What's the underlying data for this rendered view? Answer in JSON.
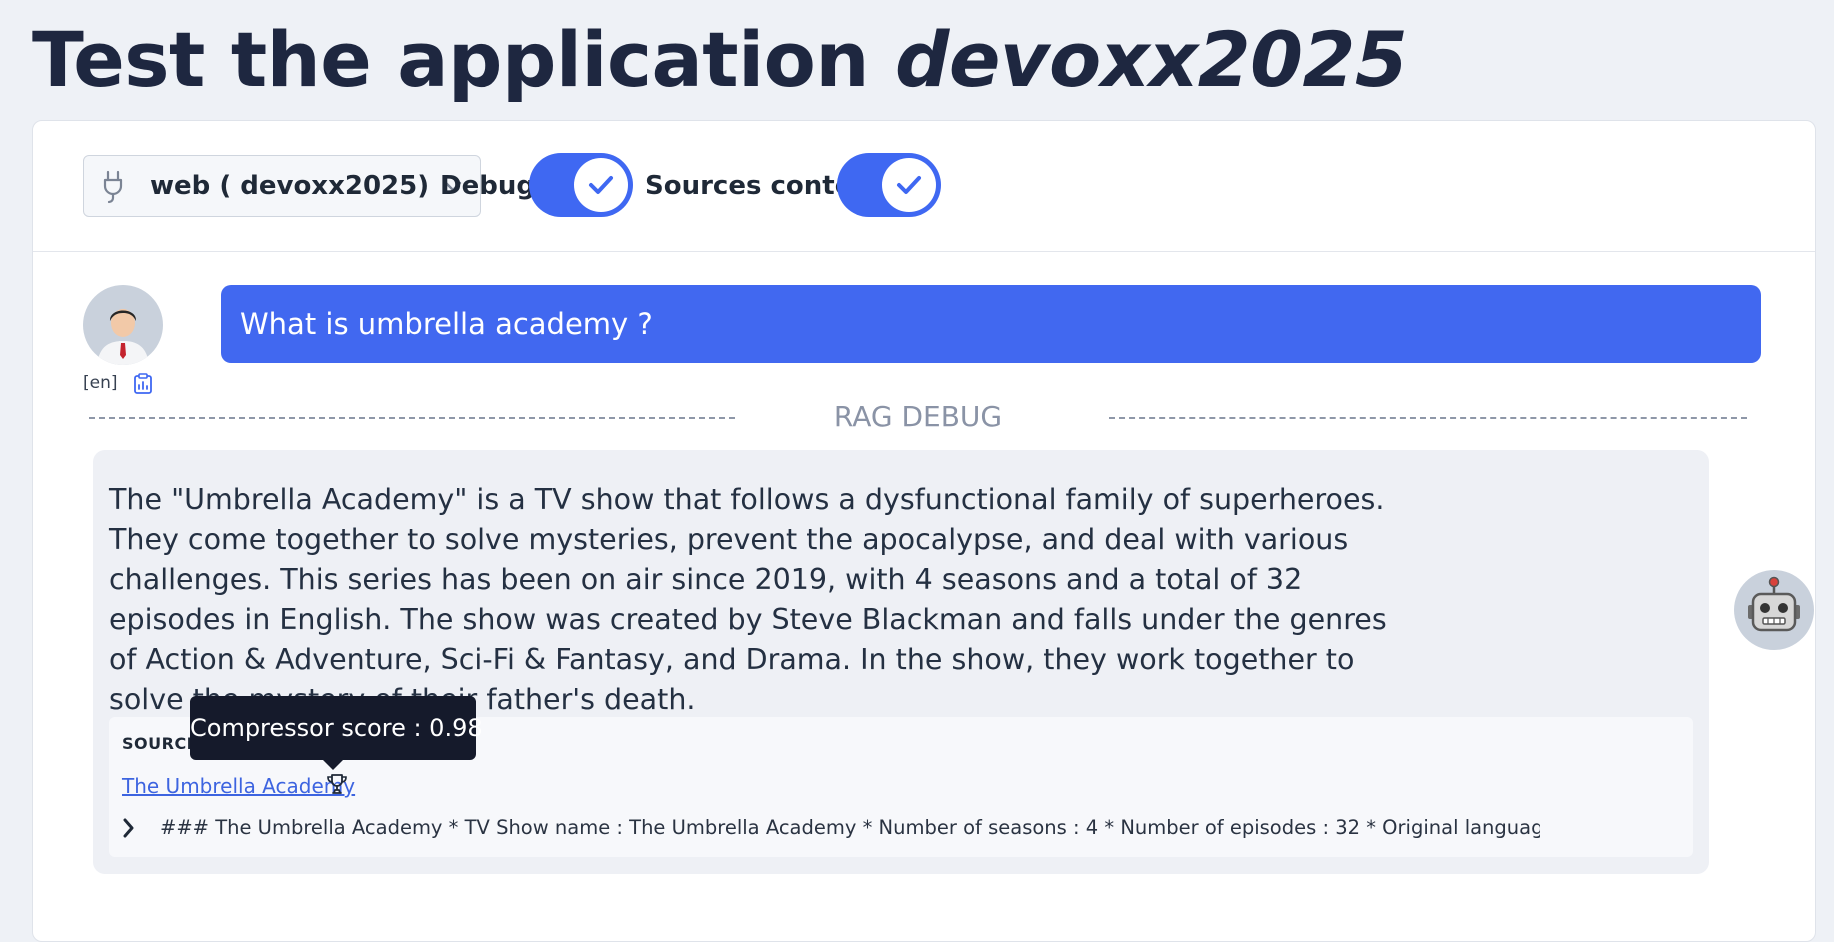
{
  "page": {
    "title_plain": "Test the application ",
    "title_italic": "devoxx2025"
  },
  "toolbar": {
    "connector": {
      "value": "web ( devoxx2025)",
      "icon": "plug-icon"
    },
    "debug": {
      "label": "Debug",
      "checked": true
    },
    "sources_content": {
      "label": "Sources content",
      "checked": true
    }
  },
  "colors": {
    "accent": "#4168f0",
    "title": "#1e2740",
    "tooltip_bg": "#151a2b"
  },
  "conversation": {
    "user": {
      "question": "What is umbrella academy ?",
      "locale": "[en]"
    },
    "divider_label": "RAG DEBUG",
    "bot": {
      "answer": "The \"Umbrella Academy\" is a TV show that follows a dysfunctional family of superheroes. They come together to solve mysteries, prevent the apocalypse, and deal with various challenges. This series has been on air since 2019, with 4 seasons and a total of 32 episodes in English. The show was created by Steve Blackman and falls under the genres of Action & Adventure, Sci-Fi & Fantasy, and Drama. In the show, they work together to solve the mystery of their father's death.",
      "sources": {
        "title": "SOURCES",
        "items": [
          {
            "link_text": "The Umbrella Academy",
            "snippet": "### The Umbrella Academy * TV Show name : The Umbrella Academy * Number of seasons : 4 * Number of episodes : 32 * Original language : en * First..."
          }
        ]
      }
    },
    "tooltip": "Compressor score : 0.98"
  }
}
